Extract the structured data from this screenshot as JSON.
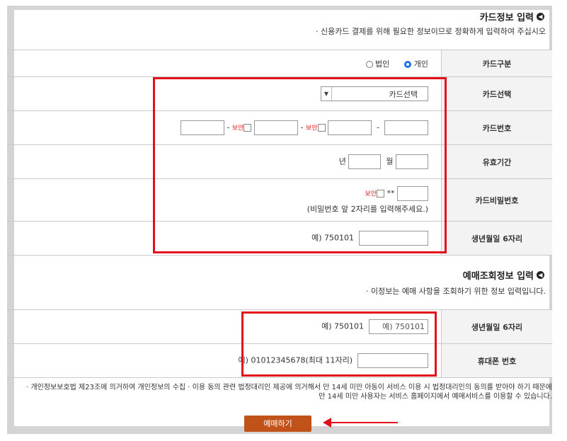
{
  "card_section": {
    "title": "카드정보 입력",
    "bullet_icon": "circle-chevron-icon",
    "desc": "· 신용카드 결제를 위해 필요한 정보이므로 정확하게 입력하여 주십시오"
  },
  "rows": {
    "card_type": {
      "label": "카드구분",
      "opt_personal": "개인",
      "opt_corporate": "법인",
      "selected": "개인"
    },
    "card_company": {
      "label": "카드선택",
      "selected": "카드선택"
    },
    "card_number": {
      "label": "카드번호",
      "dash": "-",
      "secure": "보안"
    },
    "expiry": {
      "label": "유효기간",
      "month_unit": "월",
      "year_unit": "년"
    },
    "card_password": {
      "label": "카드비밀번호",
      "stars": "**",
      "secure": "보안",
      "hint": "(비밀번호 앞 2자리를 입력해주세요.)"
    },
    "birth": {
      "label": "생년월일 6자리",
      "example": "예) 750101"
    }
  },
  "lookup_section": {
    "title": "예매조회정보 입력",
    "bullet_icon": "circle-chevron-icon",
    "desc": "· 이정보는 예매 사항을 조회하기 위한 정보 입력입니다."
  },
  "lookup_rows": {
    "birth": {
      "label": "생년월일 6자리",
      "value": "예) 750101",
      "example": "예) 750101"
    },
    "phone": {
      "label": "휴대폰 번호",
      "example": "예) 01012345678(최대 11자리)"
    }
  },
  "notice": {
    "line1": "· 개인정보보호법 제23조에 의거하여 개인정보의 수집 · 이용 동의 관련 법정대리인 제공에 의거해서 만 14세 미만 아동이 서비스 이용 시 법정대리인의 동의를 받아야 하기 때문에",
    "line2": "만 14세 미만 사용자는 서비스 홈페이지에서 예매서비스를 이용할 수 있습니다."
  },
  "submit_label": "예매하기",
  "colors": {
    "highlight": "#e3101c",
    "button": "#c1531a",
    "radio_on": "#1a73e8"
  }
}
